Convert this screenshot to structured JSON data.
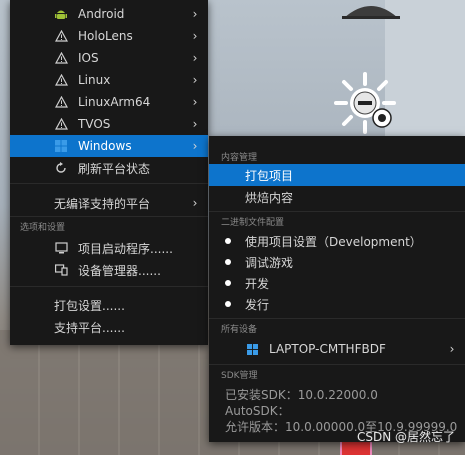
{
  "left_menu": {
    "platforms": [
      {
        "label": "Android",
        "icon": "android-icon"
      },
      {
        "label": "HoloLens",
        "icon": "warning-icon"
      },
      {
        "label": "IOS",
        "icon": "warning-icon"
      },
      {
        "label": "Linux",
        "icon": "warning-icon"
      },
      {
        "label": "LinuxArm64",
        "icon": "warning-icon"
      },
      {
        "label": "TVOS",
        "icon": "warning-icon"
      },
      {
        "label": "Windows",
        "icon": "windows-icon"
      }
    ],
    "refresh_label": "刷新平台状态",
    "unsupported_label": "无编译支持的平台",
    "options_section": "选项和设置",
    "project_launcher_label": "项目启动程序......",
    "device_manager_label": "设备管理器......",
    "packaging_settings_label": "打包设置......",
    "supported_platforms_label": "支持平台......"
  },
  "right_menu": {
    "content_section": "内容管理",
    "package_project_label": "打包项目",
    "cook_content_label": "烘焙内容",
    "binary_section": "二进制文件配置",
    "binary_options": [
      "使用项目设置（Development）",
      "调试游戏",
      "开发",
      "发行"
    ],
    "devices_section": "所有设备",
    "device_name": "LAPTOP-CMTHFBDF",
    "sdk_section": "SDK管理",
    "sdk_installed": "已安装SDK：10.0.22000.0",
    "autosdk": "AutoSDK：",
    "allowed_versions": "允许版本：10.0.00000.0至10.9.99999.0"
  },
  "watermark": "CSDN @居然忘了",
  "colors": {
    "menu_bg": "#181818",
    "highlight": "#0d74cc",
    "text": "#d6d6d6"
  }
}
